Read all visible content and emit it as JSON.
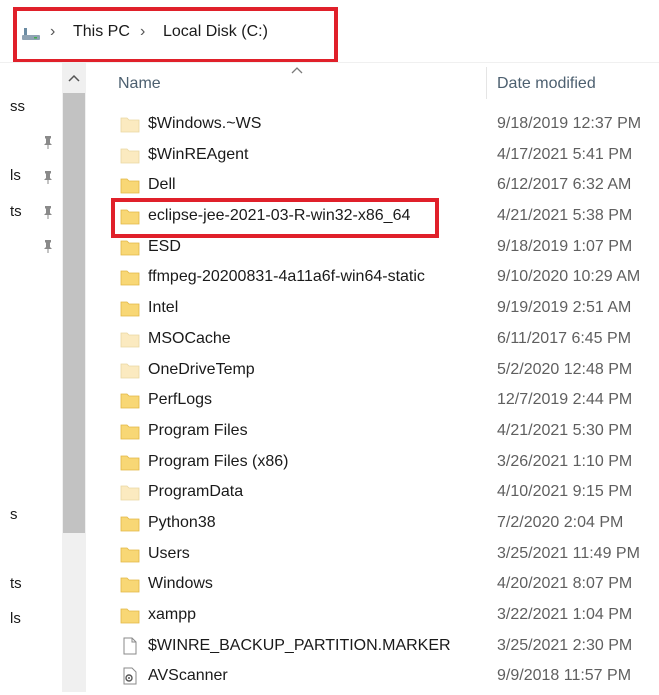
{
  "breadcrumb": {
    "items": [
      "This PC",
      "Local Disk (C:)"
    ]
  },
  "left_pane": {
    "fragments": [
      "ss",
      "ls",
      "ts",
      "s",
      "ts",
      "ls"
    ]
  },
  "columns": {
    "name": "Name",
    "date_modified": "Date modified"
  },
  "files": [
    {
      "name": "$Windows.~WS",
      "date": "9/18/2019 12:37 PM",
      "type": "folder-light"
    },
    {
      "name": "$WinREAgent",
      "date": "4/17/2021 5:41 PM",
      "type": "folder-light"
    },
    {
      "name": "Dell",
      "date": "6/12/2017 6:32 AM",
      "type": "folder"
    },
    {
      "name": "eclipse-jee-2021-03-R-win32-x86_64",
      "date": "4/21/2021 5:38 PM",
      "type": "folder"
    },
    {
      "name": "ESD",
      "date": "9/18/2019 1:07 PM",
      "type": "folder"
    },
    {
      "name": "ffmpeg-20200831-4a11a6f-win64-static",
      "date": "9/10/2020 10:29 AM",
      "type": "folder"
    },
    {
      "name": "Intel",
      "date": "9/19/2019 2:51 AM",
      "type": "folder"
    },
    {
      "name": "MSOCache",
      "date": "6/11/2017 6:45 PM",
      "type": "folder-light"
    },
    {
      "name": "OneDriveTemp",
      "date": "5/2/2020 12:48 PM",
      "type": "folder-light"
    },
    {
      "name": "PerfLogs",
      "date": "12/7/2019 2:44 PM",
      "type": "folder"
    },
    {
      "name": "Program Files",
      "date": "4/21/2021 5:30 PM",
      "type": "folder"
    },
    {
      "name": "Program Files (x86)",
      "date": "3/26/2021 1:10 PM",
      "type": "folder"
    },
    {
      "name": "ProgramData",
      "date": "4/10/2021 9:15 PM",
      "type": "folder-light"
    },
    {
      "name": "Python38",
      "date": "7/2/2020 2:04 PM",
      "type": "folder"
    },
    {
      "name": "Users",
      "date": "3/25/2021 11:49 PM",
      "type": "folder"
    },
    {
      "name": "Windows",
      "date": "4/20/2021 8:07 PM",
      "type": "folder"
    },
    {
      "name": "xampp",
      "date": "3/22/2021 1:04 PM",
      "type": "folder"
    },
    {
      "name": "$WINRE_BACKUP_PARTITION.MARKER",
      "date": "3/25/2021 2:30 PM",
      "type": "file"
    },
    {
      "name": "AVScanner",
      "date": "9/9/2018 11:57 PM",
      "type": "settings-file"
    }
  ],
  "colors": {
    "highlight": "#e0202a",
    "folder": "#f8d775",
    "folder_light": "#fbeac0",
    "header_text": "#4d6070"
  },
  "icons": {
    "breadcrumb_separator": "chevron-right-icon",
    "drive": "drive-icon",
    "pin": "pin-icon",
    "folder": "folder-icon",
    "file": "file-icon",
    "settings_file": "settings-file-icon"
  }
}
